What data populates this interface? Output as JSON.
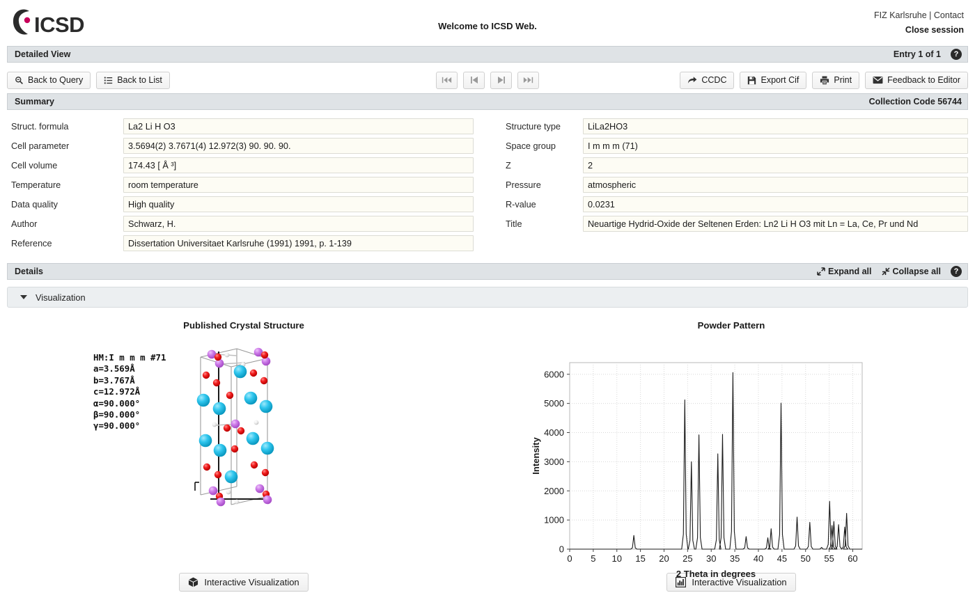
{
  "header": {
    "logo_text": "ICSD",
    "logo_icon": "icsd-c-logo",
    "welcome": "Welcome to ICSD Web.",
    "links": "FIZ Karlsruhe | Contact",
    "close_session": "Close session"
  },
  "detailed_view": {
    "title": "Detailed View",
    "entry_counter": "Entry 1 of 1",
    "help_icon": "question-mark-icon"
  },
  "toolbar": {
    "back_to_query": "Back to Query",
    "back_to_query_icon": "search-icon",
    "back_to_list": "Back to List",
    "back_to_list_icon": "list-icon",
    "nav": [
      {
        "name": "first",
        "icon": "skip-to-start-icon"
      },
      {
        "name": "previous",
        "icon": "step-backward-icon"
      },
      {
        "name": "next",
        "icon": "step-forward-icon"
      },
      {
        "name": "last",
        "icon": "skip-to-end-icon"
      }
    ],
    "ccdc": "CCDC",
    "ccdc_icon": "share-arrow-icon",
    "export_cif": "Export Cif",
    "export_cif_icon": "save-disk-icon",
    "print": "Print",
    "print_icon": "printer-icon",
    "feedback": "Feedback to Editor",
    "feedback_icon": "envelope-icon"
  },
  "summary": {
    "title": "Summary",
    "collection_code": "Collection Code 56744",
    "left_fields": [
      {
        "label": "Struct. formula",
        "value": "La2 Li H O3"
      },
      {
        "label": "Cell parameter",
        "value": "3.5694(2) 3.7671(4) 12.972(3) 90. 90. 90."
      },
      {
        "label": "Cell volume",
        "value": "174.43 [ Å ³]"
      },
      {
        "label": "Temperature",
        "value": "room temperature"
      },
      {
        "label": "Data quality",
        "value": "High quality"
      },
      {
        "label": "Author",
        "value": "Schwarz, H."
      },
      {
        "label": "Reference",
        "value": "Dissertation Universitaet Karlsruhe (1991) 1991, p. 1-139"
      }
    ],
    "right_fields": [
      {
        "label": "Structure type",
        "value": "LiLa2HO3"
      },
      {
        "label": "Space group",
        "value": "I m m m   (71)"
      },
      {
        "label": "Z",
        "value": "2"
      },
      {
        "label": "Pressure",
        "value": "atmospheric"
      },
      {
        "label": "R-value",
        "value": "0.0231"
      },
      {
        "label": "Title",
        "value": "Neuartige Hydrid-Oxide der Seltenen Erden: Ln2 Li H O3 mit Ln = La, Ce, Pr und Nd"
      }
    ]
  },
  "details": {
    "title": "Details",
    "expand_all": "Expand all",
    "collapse_all": "Collapse all",
    "expand_icon": "expand-arrows-icon",
    "collapse_icon": "collapse-arrows-icon",
    "help_icon": "question-mark-icon",
    "accordion_label": "Visualization"
  },
  "visualization": {
    "crystal": {
      "title": "Published Crystal Structure",
      "cell_info": "HM:I m m m #71\na=3.569Å\nb=3.767Å\nc=12.972Å\nα=90.000°\nβ=90.000°\nγ=90.000°",
      "button_label": "Interactive Visualization",
      "button_icon": "cube-3d-icon",
      "atom_colors": {
        "La": "#22bde8",
        "O": "#ef1b1b",
        "Li": "#cc78e8",
        "H": "#f4f4f4"
      }
    },
    "powder": {
      "title": "Powder Pattern",
      "button_label": "Interactive Visualization",
      "button_icon": "bar-chart-icon"
    }
  },
  "chart_data": {
    "type": "line",
    "title": "Powder Pattern",
    "xlabel": "2 Theta in degrees",
    "ylabel": "Intensity",
    "xlim": [
      0,
      62
    ],
    "ylim": [
      0,
      6400
    ],
    "xticks": [
      0,
      5,
      10,
      15,
      20,
      25,
      30,
      35,
      40,
      45,
      50,
      55,
      60
    ],
    "yticks": [
      0,
      1000,
      2000,
      3000,
      4000,
      5000,
      6000
    ],
    "grid": true,
    "legend": "none",
    "peaks": [
      {
        "two_theta": 13.6,
        "intensity": 470
      },
      {
        "two_theta": 24.4,
        "intensity": 5120
      },
      {
        "two_theta": 25.8,
        "intensity": 3000
      },
      {
        "two_theta": 27.4,
        "intensity": 3920
      },
      {
        "two_theta": 31.4,
        "intensity": 3270
      },
      {
        "two_theta": 32.4,
        "intensity": 3940
      },
      {
        "two_theta": 34.6,
        "intensity": 6060
      },
      {
        "two_theta": 37.4,
        "intensity": 430
      },
      {
        "two_theta": 42.0,
        "intensity": 390
      },
      {
        "two_theta": 42.7,
        "intensity": 700
      },
      {
        "two_theta": 44.8,
        "intensity": 5010
      },
      {
        "two_theta": 48.2,
        "intensity": 1100
      },
      {
        "two_theta": 50.9,
        "intensity": 920
      },
      {
        "two_theta": 53.4,
        "intensity": 60
      },
      {
        "two_theta": 55.1,
        "intensity": 1640
      },
      {
        "two_theta": 55.6,
        "intensity": 810
      },
      {
        "two_theta": 56.0,
        "intensity": 950
      },
      {
        "two_theta": 57.0,
        "intensity": 840
      },
      {
        "two_theta": 58.3,
        "intensity": 760
      },
      {
        "two_theta": 58.7,
        "intensity": 1230
      }
    ]
  }
}
